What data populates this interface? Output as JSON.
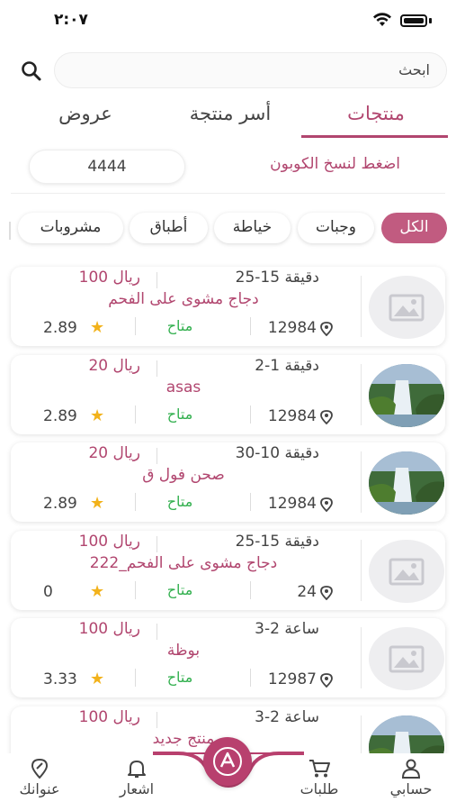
{
  "status_bar": {
    "time": "٢:٠٧"
  },
  "search": {
    "placeholder": "ابحث"
  },
  "tabs": [
    {
      "label": "منتجات",
      "active": true
    },
    {
      "label": "أسر منتجة",
      "active": false
    },
    {
      "label": "عروض",
      "active": false
    }
  ],
  "coupon": {
    "label": "اضغط لنسخ الكوبون",
    "code": "4444"
  },
  "categories": [
    {
      "label": "الكل",
      "active": true
    },
    {
      "label": "وجبات",
      "active": false
    },
    {
      "label": "خياطة",
      "active": false
    },
    {
      "label": "أطباق",
      "active": false
    },
    {
      "label": "مشروبات",
      "active": false
    }
  ],
  "products": [
    {
      "time": "25-15 دقيقة",
      "price": "100 ريال",
      "name": "دجاج مشوى على الفحم",
      "distance": "12984",
      "availability": "متاح",
      "rating": "2.89",
      "image": "placeholder-image"
    },
    {
      "time": "2-1 دقيقة",
      "price": "20 ريال",
      "name": "asas",
      "distance": "12984",
      "availability": "متاح",
      "rating": "2.89",
      "image": "waterfall-photo"
    },
    {
      "time": "30-10 دقيقة",
      "price": "20 ريال",
      "name": "صحن فول ق",
      "distance": "12984",
      "availability": "متاح",
      "rating": "2.89",
      "image": "waterfall-photo"
    },
    {
      "time": "25-15 دقيقة",
      "price": "100 ريال",
      "name": "دجاج مشوى على الفحم_222",
      "distance": "24",
      "availability": "متاح",
      "rating": "0",
      "image": "placeholder-image"
    },
    {
      "time": "3-2 ساعة",
      "price": "100 ريال",
      "name": "بوظة",
      "distance": "12987",
      "availability": "متاح",
      "rating": "3.33",
      "image": "placeholder-image"
    },
    {
      "time": "3-2 ساعة",
      "price": "100 ريال",
      "name": "منتج جديد",
      "distance": "",
      "availability": "",
      "rating": "",
      "image": "waterfall-photo"
    }
  ],
  "bottom_nav": [
    {
      "label": "حسابي",
      "icon": "person-icon"
    },
    {
      "label": "طلبات",
      "icon": "cart-icon"
    },
    {
      "label": "اشعار",
      "icon": "bell-icon"
    },
    {
      "label": "عنوانك",
      "icon": "location-edit-icon"
    }
  ],
  "colors": {
    "accent": "#b1466f",
    "chip_active": "#c15b80",
    "available": "#33b04f",
    "star": "#f2b21b"
  }
}
